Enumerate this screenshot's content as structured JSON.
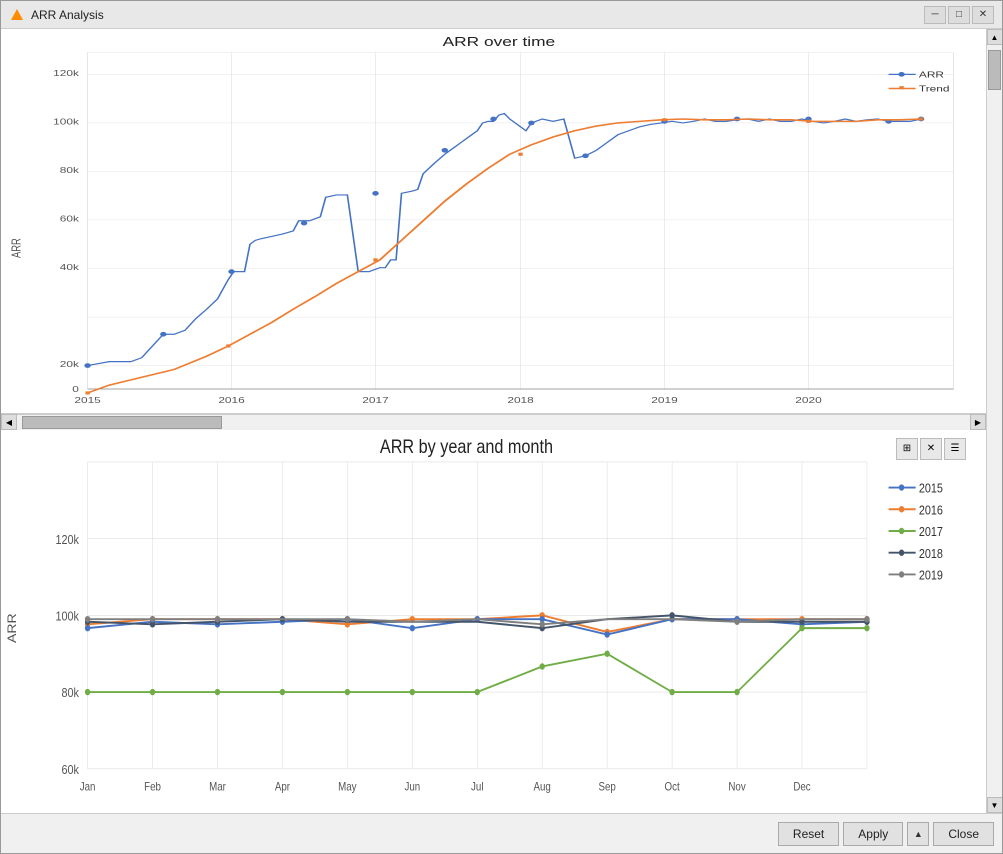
{
  "window": {
    "title": "ARR Analysis",
    "min_label": "─",
    "max_label": "□",
    "close_label": "✕"
  },
  "chart1": {
    "title": "ARR over time",
    "y_axis_label": "ARR",
    "x_ticks": [
      "2015",
      "2016",
      "2017",
      "2018",
      "2019",
      "2020"
    ],
    "y_ticks": [
      "0",
      "20k",
      "40k",
      "60k",
      "80k",
      "100k",
      "120k"
    ],
    "legend": [
      {
        "label": "ARR",
        "color": "#4472c4"
      },
      {
        "label": "Trend",
        "color": "#ed7d31"
      }
    ]
  },
  "chart2": {
    "title": "ARR by year and month",
    "y_axis_label": "ARR",
    "x_ticks": [
      "Jan",
      "Feb",
      "Mar",
      "Apr",
      "May",
      "Jun",
      "Jul",
      "Aug",
      "Sep",
      "Oct",
      "Nov",
      "Dec"
    ],
    "y_ticks": [
      "60k",
      "80k",
      "100k",
      "120k"
    ],
    "legend": [
      {
        "label": "2015",
        "color": "#4472c4"
      },
      {
        "label": "2016",
        "color": "#ed7d31"
      },
      {
        "label": "2017",
        "color": "#70ad47"
      },
      {
        "label": "2018",
        "color": "#44546a"
      },
      {
        "label": "2019",
        "color": "#7f7f7f"
      }
    ]
  },
  "buttons": {
    "reset_label": "Reset",
    "apply_label": "Apply",
    "close_label": "Close"
  }
}
